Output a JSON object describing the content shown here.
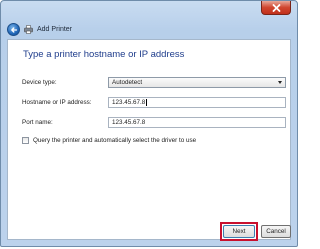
{
  "window": {
    "title": "Add Printer"
  },
  "content": {
    "heading": "Type a printer hostname or IP address",
    "device_type_label": "Device type:",
    "device_type_value": "Autodetect",
    "hostname_label": "Hostname or IP address:",
    "hostname_value": "123.45.67.8",
    "port_label": "Port name:",
    "port_value": "123.45.67.8",
    "query_checkbox_label": "Query the printer and automatically select the driver to use",
    "query_checked": false
  },
  "footer": {
    "next_label": "Next",
    "cancel_label": "Cancel"
  },
  "colors": {
    "heading": "#1f3d8c",
    "highlight": "#c8102e"
  }
}
